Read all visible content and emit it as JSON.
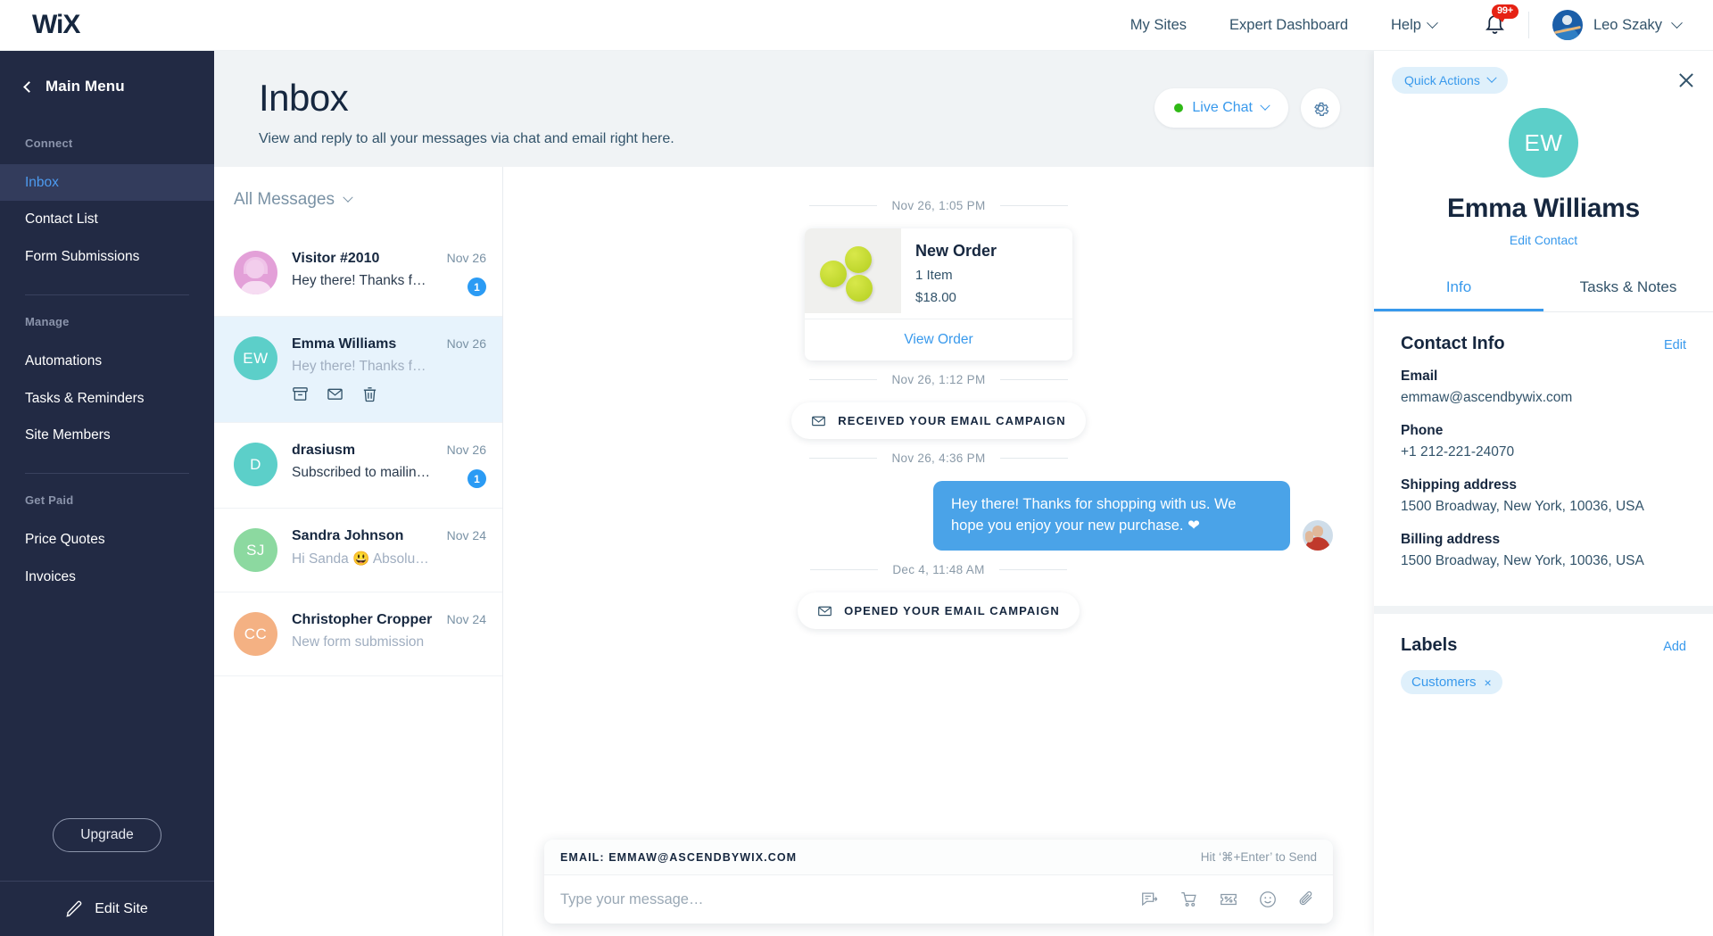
{
  "topbar": {
    "logo": "WiX",
    "nav": [
      {
        "label": "My Sites",
        "caret": false
      },
      {
        "label": "Expert Dashboard",
        "caret": false
      },
      {
        "label": "Help",
        "caret": true
      }
    ],
    "notification_count": "99+",
    "user_name": "Leo Szaky"
  },
  "sidebar": {
    "main_menu": "Main Menu",
    "groups": [
      {
        "title": "Connect",
        "items": [
          {
            "label": "Inbox",
            "active": true
          },
          {
            "label": "Contact List",
            "active": false
          },
          {
            "label": "Form Submissions",
            "active": false
          }
        ]
      },
      {
        "title": "Manage",
        "items": [
          {
            "label": "Automations",
            "active": false
          },
          {
            "label": "Tasks & Reminders",
            "active": false
          },
          {
            "label": "Site Members",
            "active": false
          }
        ]
      },
      {
        "title": "Get Paid",
        "items": [
          {
            "label": "Price Quotes",
            "active": false
          },
          {
            "label": "Invoices",
            "active": false
          }
        ]
      }
    ],
    "upgrade": "Upgrade",
    "edit_site": "Edit Site"
  },
  "inbox": {
    "title": "Inbox",
    "subtitle": "View and reply to all your messages via chat and email right here.",
    "live_chat_label": "Live Chat",
    "live_chat_status_color": "#2fb916"
  },
  "conversations": {
    "filter_label": "All Messages",
    "items": [
      {
        "name": "Visitor #2010",
        "preview": "Hey there! Thanks for …",
        "date": "Nov 26",
        "unread": "1",
        "initials": "",
        "avatar_type": "illustration",
        "avatar_color": "#e3a0d8",
        "selected": false
      },
      {
        "name": "Emma Williams",
        "preview": "Hey there! Thanks for sho…",
        "date": "Nov 26",
        "unread": "",
        "initials": "EW",
        "avatar_type": "initials",
        "avatar_color": "#5ccfc9",
        "selected": true
      },
      {
        "name": "drasiusm",
        "preview": "Subscribed to mailing …",
        "date": "Nov 26",
        "unread": "1",
        "initials": "D",
        "avatar_type": "initials",
        "avatar_color": "#5ccfc9",
        "selected": false
      },
      {
        "name": "Sandra Johnson",
        "preview": "Hi Sanda 😃 Absolutely! …",
        "date": "Nov 24",
        "unread": "",
        "initials": "SJ",
        "avatar_type": "initials",
        "avatar_color": "#8cd9a0",
        "selected": false
      },
      {
        "name": "Christopher Cropper",
        "preview": "New form submission",
        "date": "Nov 24",
        "unread": "",
        "initials": "CC",
        "avatar_type": "initials",
        "avatar_color": "#f4b183",
        "selected": false
      }
    ],
    "row_actions": [
      "archive-icon",
      "mark-unread-icon",
      "delete-icon"
    ]
  },
  "chat": {
    "timestamps": {
      "order": "Nov 26, 1:05 PM",
      "received_campaign": "Nov 26, 1:12 PM",
      "reply": "Nov 26, 4:36 PM",
      "opened_campaign": "Dec 4, 11:48 AM"
    },
    "order_card": {
      "title": "New Order",
      "items": "1 Item",
      "total": "$18.00",
      "action": "View Order"
    },
    "events": {
      "received": "RECEIVED YOUR EMAIL CAMPAIGN",
      "opened": "OPENED YOUR EMAIL CAMPAIGN"
    },
    "message": "Hey there! Thanks for shopping with us. We hope you enjoy your new purchase. ❤",
    "composer": {
      "channel": "EMAIL: EMMAW@ASCENDBYWIX.COM",
      "send_hint": "Hit ‘⌘+Enter’ to Send",
      "placeholder": "Type your message…",
      "value": "",
      "icons": [
        "quick-reply-icon",
        "cart-icon",
        "coupon-icon",
        "emoji-icon",
        "attachment-icon"
      ]
    }
  },
  "contact_panel": {
    "quick_actions": "Quick Actions",
    "avatar_initials": "EW",
    "name": "Emma Williams",
    "edit_contact": "Edit Contact",
    "tabs": [
      {
        "label": "Info",
        "active": true
      },
      {
        "label": "Tasks & Notes",
        "active": false
      }
    ],
    "contact_info": {
      "title": "Contact Info",
      "edit": "Edit",
      "fields": [
        {
          "label": "Email",
          "value": "emmaw@ascendbywix.com"
        },
        {
          "label": "Phone",
          "value": "+1 212-221-24070"
        },
        {
          "label": "Shipping address",
          "value": "1500 Broadway, New York, 10036, USA"
        },
        {
          "label": "Billing address",
          "value": "1500 Broadway, New York, 10036, USA"
        }
      ]
    },
    "labels": {
      "title": "Labels",
      "add": "Add",
      "chips": [
        "Customers"
      ]
    }
  }
}
